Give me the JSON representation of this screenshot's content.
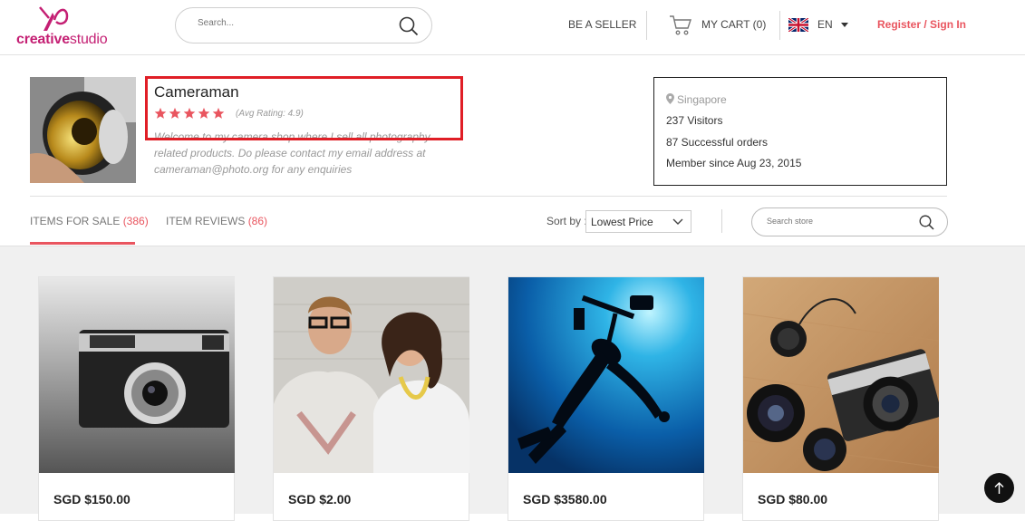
{
  "header": {
    "logo_bold": "creative",
    "logo_light": "studio",
    "search_placeholder": "Search...",
    "be_a_seller": "BE A SELLER",
    "cart_label": "MY CART (0)",
    "language": "EN",
    "signin": "Register / Sign In"
  },
  "shop": {
    "name": "Cameraman",
    "stars": 5,
    "avg_rating": "(Avg Rating: 4.9)",
    "description": "Welcome to my camera shop where I sell all photography related products. Do please contact my email address at cameraman@photo.org for any enquiries"
  },
  "info": {
    "location": "Singapore",
    "visitors": "237 Visitors",
    "orders": "87 Successful orders",
    "member_since": "Member since Aug 23, 2015"
  },
  "tabs": [
    {
      "label": "ITEMS FOR SALE ",
      "count": "(386)"
    },
    {
      "label": "ITEM REVIEWS ",
      "count": "(86)"
    }
  ],
  "sort": {
    "label": "Sort by :",
    "selected": "Lowest Price"
  },
  "store_search_placeholder": "Search store",
  "products": [
    {
      "price": "SGD $150.00",
      "image": "vintage-camera-photo"
    },
    {
      "price": "SGD $2.00",
      "image": "couple-photo"
    },
    {
      "price": "SGD $3580.00",
      "image": "underwater-diver-photo"
    },
    {
      "price": "SGD $80.00",
      "image": "camera-and-lenses-photo"
    }
  ],
  "colors": {
    "brand": "#c41f73",
    "accent": "#e9555f",
    "highlight_box": "#e01e26"
  }
}
